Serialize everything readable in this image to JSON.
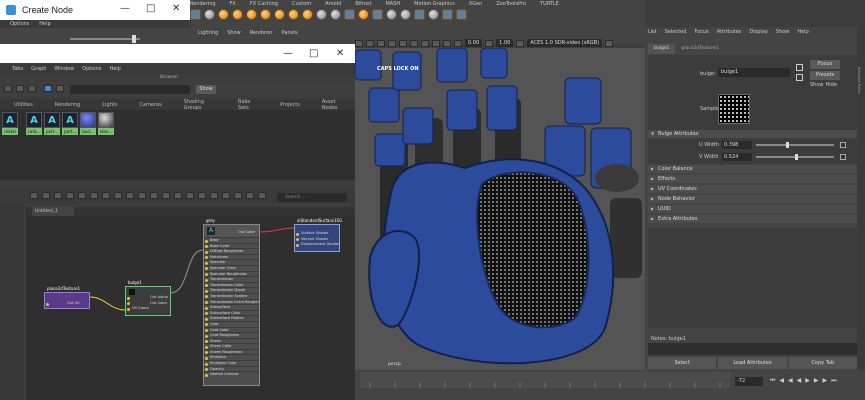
{
  "shelf": {
    "tabs": [
      "Rendering",
      "FX",
      "FX Caching",
      "Custom",
      "Arnold",
      "Bifrost",
      "MASH",
      "Motion Graphics",
      "XGen",
      "ZooToolsPro",
      "TURTLE"
    ]
  },
  "viewport": {
    "menu": [
      "Lighting",
      "Show",
      "Renderer",
      "Panels"
    ],
    "near_value": "0.00",
    "far_value": "1.00",
    "color_space": "ACES 1.0 SDR-video (sRGB)",
    "caps_lock_label": "CAPS LOCK ON",
    "camera_label": "persp"
  },
  "create_node": {
    "title": "Create Node",
    "menu": [
      "Options",
      "Help"
    ]
  },
  "hypershade": {
    "menu": [
      "Tabs",
      "Graph",
      "Window",
      "Options",
      "Help"
    ],
    "browser_label": "Browser",
    "show_button": "Show",
    "tabs": [
      "Utilities",
      "Rendering",
      "Lights",
      "Cameras",
      "Shading Groups",
      "Bake Sets",
      "Projects",
      "Asset Nodes"
    ],
    "swatches": [
      {
        "name": "metal"
      },
      {
        "name": "carb..."
      },
      {
        "name": "part..."
      },
      {
        "name": "part..."
      },
      {
        "name": "bud..."
      },
      {
        "name": "stan..."
      }
    ],
    "node_editor": {
      "tab_label": "Untitled_1",
      "search_placeholder": "Search..."
    }
  },
  "nodes": {
    "place2d": {
      "title": "place2dTexture1",
      "rows": [
        "Out UV"
      ]
    },
    "bulge": {
      "title": "bulge1",
      "rows": [
        "Out Alpha",
        "Out Color",
        "UV Coord"
      ]
    },
    "grey": {
      "title": "grey",
      "rows": [
        "Base",
        "Base Color",
        "Diffuse Roughness",
        "Metalness",
        "Specular",
        "Specular Color",
        "Specular Roughness",
        "Transmission",
        "Transmission Color",
        "Transmission Depth",
        "Transmission Scatter",
        "Transmission Extra Roughness",
        "Subsurface",
        "Subsurface Color",
        "Subsurface Radius",
        "Coat",
        "Coat Color",
        "Coat Roughness",
        "Sheen",
        "Sheen Color",
        "Sheen Roughness",
        "Emission",
        "Emission Color",
        "Opacity",
        "Normal Camera"
      ]
    },
    "sg": {
      "title": "aiStandardSurface1SG",
      "rows": [
        "Surface Shader",
        "Volume Shader",
        "Displacement Shader"
      ]
    }
  },
  "attribute_editor": {
    "menu": [
      "List",
      "Selected",
      "Focus",
      "Attributes",
      "Display",
      "Show",
      "Help"
    ],
    "tabs": [
      "bulge1",
      "place2dTexture1"
    ],
    "node_type_label": "bulge:",
    "node_name": "bulge1",
    "focus_button": "Focus",
    "presets_button": "Presets",
    "show_button": "Show",
    "hide_button": "Hide",
    "sample_label": "Sample",
    "section_title": "Bulge Attributes",
    "u_width_label": "U Width",
    "u_width_value": "0.398",
    "v_width_label": "V Width",
    "v_width_value": "0.524",
    "u_width_level": 0.398,
    "v_width_level": 0.524,
    "sections": [
      "Color Balance",
      "Effects",
      "UV Coordinates",
      "Node Behavior",
      "UUID",
      "Extra Attributes"
    ],
    "notes_label": "Notes: bulge1",
    "buttons": [
      "Select",
      "Load Attributes",
      "Copy Tab"
    ]
  },
  "right_strip_label": "Attribute Editor",
  "timeline": {
    "current_frame": "-72"
  },
  "colors": {
    "glove_blue": "#2d4b9c",
    "node_purple": "#5a3a8a",
    "node_green_border": "#5ad07a",
    "node_blue": "#33457a"
  }
}
